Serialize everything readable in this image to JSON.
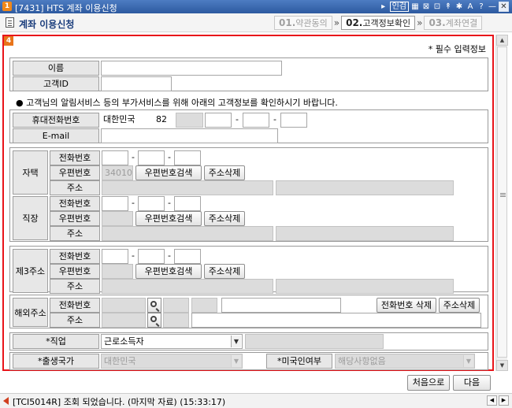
{
  "window": {
    "app_badge": "1",
    "title": "[7431] HTS 계좌 이용신청",
    "controls": [
      "▸",
      "인검",
      "▦",
      "⊠",
      "⊡",
      "↟",
      "✱",
      "A",
      "?",
      "—",
      "✕"
    ]
  },
  "header": {
    "title": "계좌 이용신청",
    "steps": [
      {
        "num": "01.",
        "label": "약관동의",
        "active": false
      },
      {
        "num": "02.",
        "label": "고객정보확인",
        "active": true
      },
      {
        "num": "03.",
        "label": "계좌연결",
        "active": false
      }
    ],
    "step_arrow": "»"
  },
  "panel": {
    "badge": "4",
    "required_note": "* 필수 입력정보"
  },
  "identity": {
    "name_label": "이름",
    "name_value": "",
    "customer_id_label": "고객ID",
    "customer_id_value": ""
  },
  "notice": "● 고객님의 알림서비스 등의 부가서비스를 위해 아래의 고객정보를 확인하시기 바랍니다.",
  "contact": {
    "mobile_label": "휴대전화번호",
    "country": "대한민국",
    "country_code": "82",
    "email_label": "E-mail",
    "dash": "-"
  },
  "home": {
    "group_label": "자택",
    "phone_label": "전화번호",
    "zip_label": "우편번호",
    "zip_value": "34010",
    "address_label": "주소",
    "zip_search_button": "우편번호검색",
    "address_delete_button": "주소삭제"
  },
  "work": {
    "group_label": "직장",
    "phone_label": "전화번호",
    "zip_label": "우편번호",
    "address_label": "주소",
    "zip_search_button": "우편번호검색",
    "address_delete_button": "주소삭제"
  },
  "third": {
    "group_label": "제3주소",
    "phone_label": "전화번호",
    "zip_label": "우편번호",
    "address_label": "주소",
    "zip_search_button": "우편번호검색",
    "address_delete_button": "주소삭제"
  },
  "overseas": {
    "group_label": "해외주소",
    "phone_label": "전화번호",
    "address_label": "주소",
    "phone_delete_button": "전화번호 삭제",
    "address_delete_button": "주소삭제"
  },
  "job": {
    "label": "*직업",
    "selected": "근로소득자"
  },
  "nationality": {
    "birth_country_label": "*출생국가",
    "birth_country_value": "대한민국",
    "us_person_label": "*미국인여부",
    "us_person_value": "해당사항없음"
  },
  "footer": {
    "first_button": "처음으로",
    "next_button": "다음"
  },
  "status": {
    "message": "[TCI5014R] 조회 되었습니다. (마지막 자료) (15:33:17)"
  },
  "icons": {
    "dropdown": "▼",
    "scroll_up": "▲",
    "scroll_down": "▼",
    "status_left": "◀",
    "status_right": "▶"
  }
}
